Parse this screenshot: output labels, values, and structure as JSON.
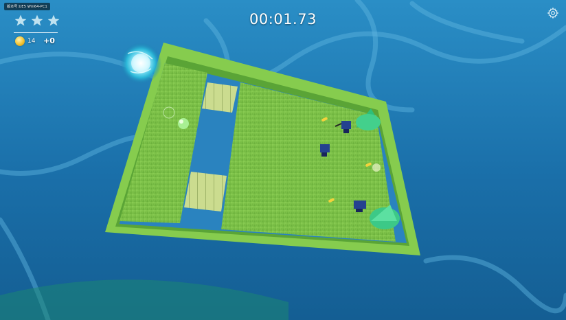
{
  "hud": {
    "build_tag": "版本号:UE5 Win64-PC1",
    "stars_earned": 3,
    "stars_total": 3,
    "coin_count": "14",
    "bonus": "+0",
    "timer": "00:01.73"
  },
  "icons": {
    "star": "star-icon",
    "coin": "coin-icon",
    "settings": "gear-icon"
  },
  "colors": {
    "water": "#1d74ad",
    "grass": "#7fc44a",
    "wall": "#8fd24f",
    "plank": "#c9d98e",
    "star": "#bfe2f0",
    "coin": "#f2c230"
  }
}
